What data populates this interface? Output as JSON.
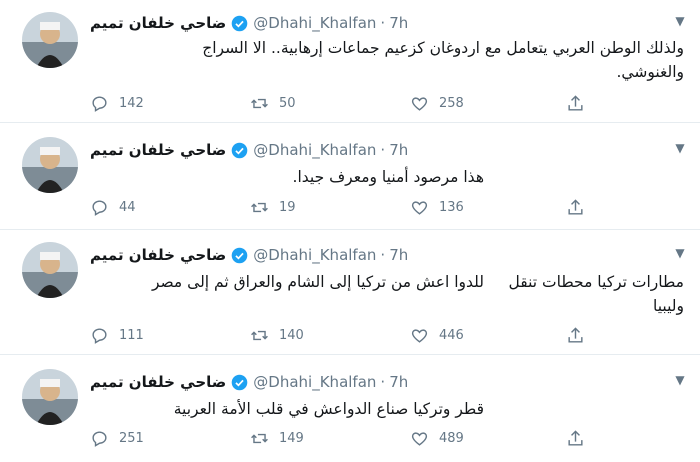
{
  "tweets": [
    {
      "name": "ضاحي خلفان تميم",
      "handle": "@Dhahi_Khalfan",
      "separator": "·",
      "time": "7h",
      "text_lines": [
        "ولذلك الوطن العربي يتعامل مع اردوغان كزعيم جماعات إرهابية.. الا السراج",
        "والغنوشي."
      ],
      "replies": "142",
      "retweets": "50",
      "likes": "258"
    },
    {
      "name": "ضاحي خلفان تميم",
      "handle": "@Dhahi_Khalfan",
      "separator": "·",
      "time": "7h",
      "text_lines": [
        "هذا مرصود أمنيا ومعرف جيدا."
      ],
      "replies": "44",
      "retweets": "19",
      "likes": "136"
    },
    {
      "name": "ضاحي خلفان تميم",
      "handle": "@Dhahi_Khalfan",
      "separator": "·",
      "time": "7h",
      "text_lines": [
        "مطارات تركيا محطات تنقل",
        "للدوا اعش من تركيا إلى الشام والعراق ثم إلى مصر",
        "وليبيا"
      ],
      "replies": "111",
      "retweets": "140",
      "likes": "446"
    },
    {
      "name": "ضاحي خلفان تميم",
      "handle": "@Dhahi_Khalfan",
      "separator": "·",
      "time": "7h",
      "text_lines": [
        "قطر وتركيا صناع الدواعش في قلب الأمة العربية"
      ],
      "replies": "251",
      "retweets": "149",
      "likes": "489"
    }
  ],
  "colors": {
    "verified": "#1da1f2",
    "muted": "#657786",
    "text": "#14171a",
    "divider": "#e6ecf0"
  },
  "icons": [
    "verified-icon",
    "reply-icon",
    "retweet-icon",
    "like-icon",
    "share-icon",
    "chevron-down-icon"
  ]
}
